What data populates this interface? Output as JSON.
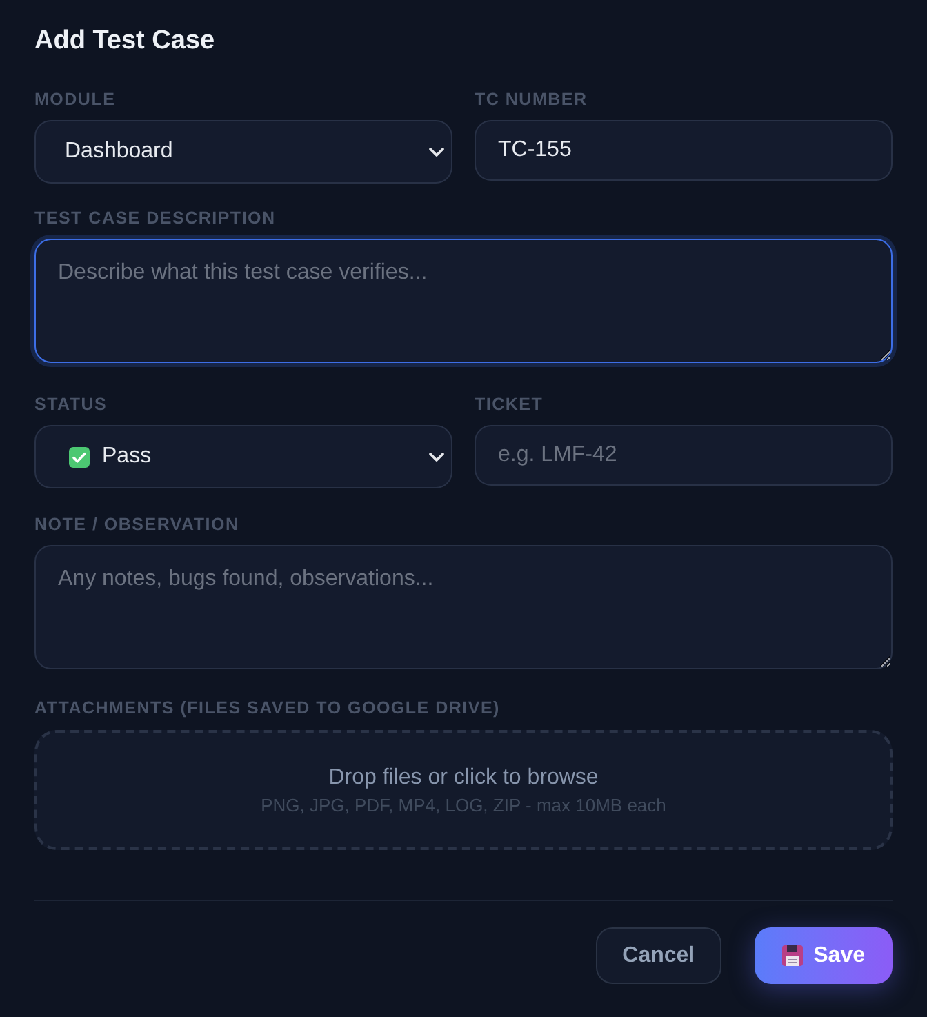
{
  "title": "Add Test Case",
  "rows": [
    {
      "fields": [
        {
          "kind": "select",
          "label": "MODULE",
          "value": "Dashboard",
          "focused": false
        },
        {
          "kind": "text",
          "label": "TC NUMBER",
          "value": "TC-155",
          "focused": false
        }
      ]
    },
    {
      "fields": [
        {
          "kind": "textarea",
          "label": "TEST CASE DESCRIPTION",
          "placeholder": "Describe what this test case verifies...",
          "focused": true
        }
      ]
    },
    {
      "fields": [
        {
          "kind": "status_select",
          "label": "STATUS",
          "value": "Pass",
          "focused": false
        },
        {
          "kind": "text",
          "label": "TICKET",
          "placeholder": "e.g. LMF-42",
          "focused": false
        }
      ]
    },
    {
      "fields": [
        {
          "kind": "textarea",
          "label": "NOTE / OBSERVATION",
          "placeholder": "Any notes, bugs found, observations...",
          "focused": false
        }
      ]
    },
    {
      "fields": [
        {
          "kind": "dropzone",
          "label": "ATTACHMENTS (FILES SAVED TO GOOGLE DRIVE)",
          "prompt": "Drop files or click to browse",
          "hint": "PNG, JPG, PDF, MP4, LOG, ZIP - max 10MB each"
        }
      ]
    }
  ],
  "buttons": [
    {
      "kind": "secondary",
      "label": "Cancel"
    },
    {
      "kind": "primary",
      "label": "Save"
    }
  ]
}
